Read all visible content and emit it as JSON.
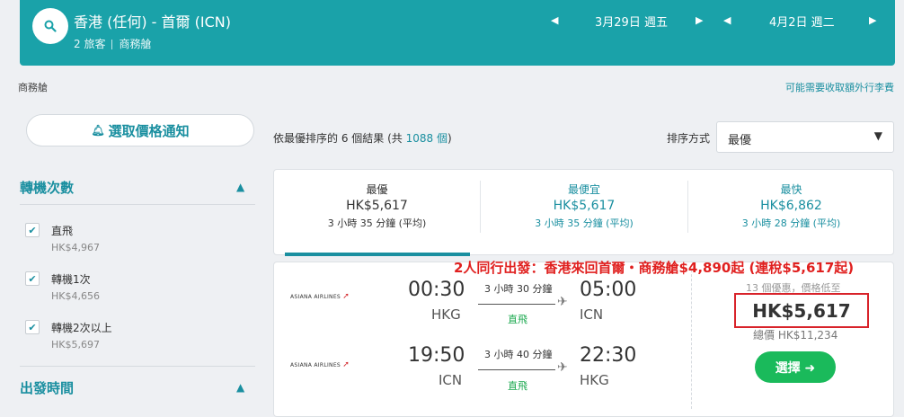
{
  "header": {
    "route": "香港 (任何) - 首爾 (ICN)",
    "travelers": "2 旅客",
    "cabin": "商務艙",
    "depart_date": "3月29日 週五",
    "return_date": "4月2日 週二",
    "accent": "#1aa2a9"
  },
  "subheader": {
    "cabin_note": "商務艙",
    "fee_link": "可能需要收取額外行李費"
  },
  "sidebar": {
    "alert_button": "選取價格通知",
    "stops_title": "轉機次數",
    "stops": [
      {
        "label": "直飛",
        "price": "HK$4,967",
        "checked": true
      },
      {
        "label": "轉機1次",
        "price": "HK$4,656",
        "checked": true
      },
      {
        "label": "轉機2次以上",
        "price": "HK$5,697",
        "checked": true
      }
    ],
    "depart_time_title": "出發時間"
  },
  "results": {
    "info_prefix": "依最優排序的 6 個結果 (共",
    "info_count": "1088 個",
    "info_suffix": ")",
    "sort_label": "排序方式",
    "sort_value": "最優"
  },
  "tabs": [
    {
      "title": "最優",
      "price": "HK$5,617",
      "duration": "3 小時 35 分鐘 (平均)",
      "active": true
    },
    {
      "title": "最便宜",
      "price": "HK$5,617",
      "duration": "3 小時 35 分鐘 (平均)",
      "active": false
    },
    {
      "title": "最快",
      "price": "HK$6,862",
      "duration": "3 小時 28 分鐘 (平均)",
      "active": false
    }
  ],
  "promo": "2人同行出發：香港來回首爾・商務艙$4,890起 (連稅$5,617起)",
  "card": {
    "legs": [
      {
        "airline": "ASIANA AIRLINES",
        "dep_time": "00:30",
        "dep_code": "HKG",
        "duration": "3 小時 30 分鐘",
        "stops": "直飛",
        "arr_time": "05:00",
        "arr_code": "ICN"
      },
      {
        "airline": "ASIANA AIRLINES",
        "dep_time": "19:50",
        "dep_code": "ICN",
        "duration": "3 小時 40 分鐘",
        "stops": "直飛",
        "arr_time": "22:30",
        "arr_code": "HKG"
      }
    ],
    "offers": "13 個優惠，價格低至",
    "price": "HK$5,617",
    "total": "總價 HK$11,234",
    "select_button": "選擇 ➜"
  }
}
